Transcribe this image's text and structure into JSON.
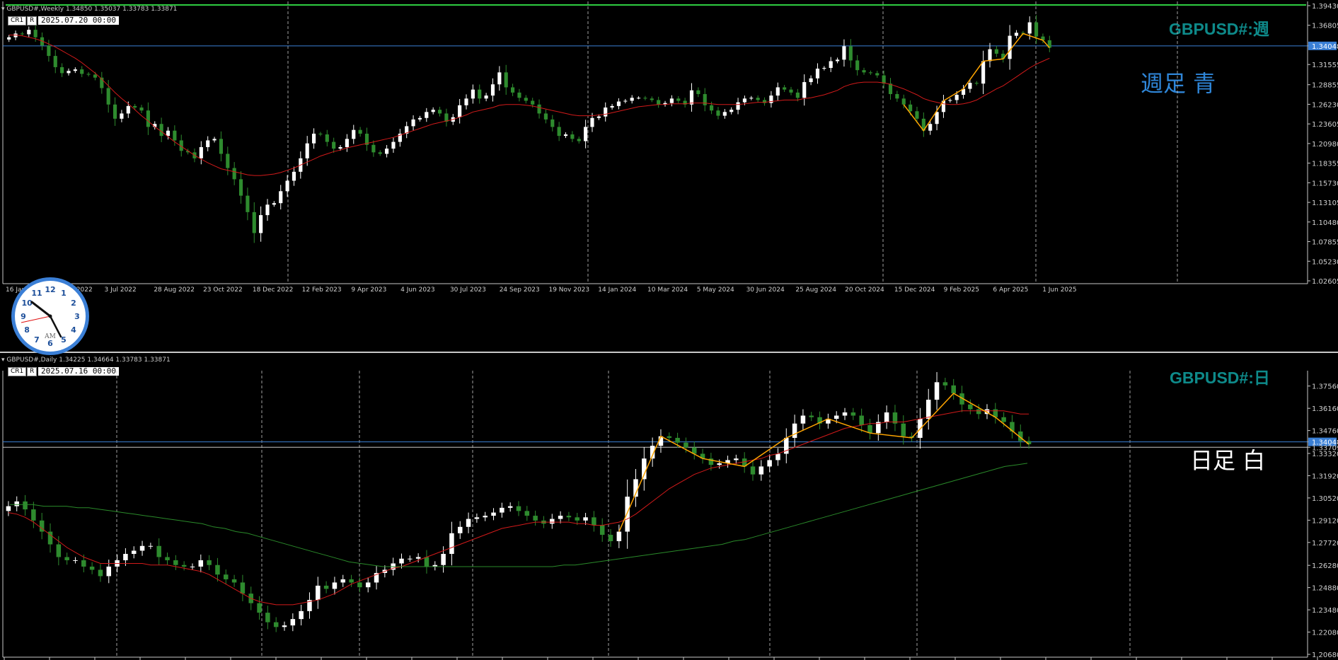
{
  "weekly": {
    "header": "GBPUSD#,Weekly  1.34850 1.35037 1.33783 1.33871",
    "tags": [
      "CR1",
      "R"
    ],
    "date": "2025.07.20 00:00",
    "symbol_label": "GBPUSD#:週",
    "note": "週足 青",
    "current_price_label": "1.34048"
  },
  "daily": {
    "header": "GBPUSD#,Daily  1.34225 1.34664 1.33783 1.33871",
    "tags": [
      "CR1",
      "R"
    ],
    "date": "2025.07.16 00:00",
    "symbol_label": "GBPUSD#:日",
    "note": "日足 白",
    "current_price_label": "1.34048",
    "secondary_price_label": "1.33709"
  },
  "clock": {
    "numbers": [
      "12",
      "1",
      "2",
      "3",
      "4",
      "5",
      "6",
      "7",
      "8",
      "9",
      "10",
      "11"
    ],
    "am_label": "AM"
  },
  "colors": {
    "background": "#000000",
    "bull_candle": "#ffffff",
    "bear_candle": "#2e8b2e",
    "ma_red": "#d21a1a",
    "ma_green": "#2a8a2a",
    "zigzag": "#ffa500",
    "price_line": "#3a7fd5",
    "grid": "#c8c8c8",
    "symbol_label": "#0e8a8a",
    "note_weekly": "#2f86d8",
    "note_daily": "#ffffff"
  },
  "chart_data": [
    {
      "type": "line",
      "title": "GBPUSD#,Weekly",
      "y_ticks": [
        "1.39430",
        "1.36805",
        "1.34048",
        "1.31555",
        "1.28855",
        "1.26230",
        "1.23605",
        "1.20980",
        "1.18355",
        "1.15730",
        "1.13105",
        "1.10480",
        "1.07855",
        "1.05230",
        "1.02605"
      ],
      "x_ticks": [
        "16 Jan 2022",
        "8 May 2022",
        "3 Jul 2022",
        "28 Aug 2022",
        "23 Oct 2022",
        "18 Dec 2022",
        "12 Feb 2023",
        "9 Apr 2023",
        "4 Jun 2023",
        "30 Jul 2023",
        "24 Sep 2023",
        "19 Nov 2023",
        "14 Jan 2024",
        "10 Mar 2024",
        "5 May 2024",
        "30 Jun 2024",
        "25 Aug 2024",
        "20 Oct 2024",
        "15 Dec 2024",
        "9 Feb 2025",
        "6 Apr 2025",
        "1 Jun 2025"
      ],
      "ylim": [
        1.02605,
        1.3943
      ],
      "price_line": 1.34048,
      "series": [
        {
          "name": "",
          "values": [
            1.352,
            1.357,
            1.356,
            1.362,
            1.352,
            1.341,
            1.327,
            1.312,
            1.304,
            1.307,
            1.309,
            1.303,
            1.302,
            1.298,
            1.284,
            1.262,
            1.243,
            1.25,
            1.26,
            1.258,
            1.254,
            1.232,
            1.236,
            1.22,
            1.227,
            1.214,
            1.2,
            1.198,
            1.19,
            1.205,
            1.214,
            1.216,
            1.196,
            1.177,
            1.162,
            1.14,
            1.118,
            1.09,
            1.114,
            1.128,
            1.13,
            1.146,
            1.16,
            1.172,
            1.19,
            1.21,
            1.223,
            1.222,
            1.212,
            1.203,
            1.205,
            1.216,
            1.228,
            1.223,
            1.208,
            1.198,
            1.196,
            1.203,
            1.212,
            1.223,
            1.233,
            1.242,
            1.244,
            1.252,
            1.255,
            1.25,
            1.239,
            1.245,
            1.261,
            1.27,
            1.282,
            1.27,
            1.274,
            1.289,
            1.305,
            1.285,
            1.278,
            1.271,
            1.267,
            1.262,
            1.25,
            1.242,
            1.232,
            1.22,
            1.222,
            1.216,
            1.213,
            1.232,
            1.244,
            1.246,
            1.258,
            1.26,
            1.266,
            1.267,
            1.271,
            1.271,
            1.27,
            1.268,
            1.262,
            1.264,
            1.27,
            1.267,
            1.262,
            1.281,
            1.276,
            1.261,
            1.254,
            1.247,
            1.252,
            1.255,
            1.265,
            1.27,
            1.271,
            1.268,
            1.264,
            1.274,
            1.285,
            1.282,
            1.278,
            1.271,
            1.292,
            1.297,
            1.31,
            1.311,
            1.32,
            1.322,
            1.34,
            1.321,
            1.308,
            1.305,
            1.304,
            1.301,
            1.29,
            1.276,
            1.27,
            1.262,
            1.253,
            1.243,
            1.227,
            1.236,
            1.252,
            1.267,
            1.268,
            1.275,
            1.283,
            1.291,
            1.29,
            1.32,
            1.336,
            1.33,
            1.323,
            1.354,
            1.358,
            1.357,
            1.372,
            1.353,
            1.348,
            1.338
          ]
        },
        {
          "name": "",
          "values": [
            1.355,
            1.355,
            1.354,
            1.352,
            1.35,
            1.347,
            1.343,
            1.339,
            1.334,
            1.329,
            1.324,
            1.318,
            1.311,
            1.304,
            1.296,
            1.287,
            1.278,
            1.27,
            1.263,
            1.255,
            1.247,
            1.24,
            1.232,
            1.226,
            1.219,
            1.212,
            1.206,
            1.2,
            1.194,
            1.189,
            1.184,
            1.18,
            1.176,
            1.174,
            1.172,
            1.17,
            1.168,
            1.167,
            1.167,
            1.168,
            1.169,
            1.171,
            1.174,
            1.177,
            1.181,
            1.185,
            1.189,
            1.193,
            1.196,
            1.199,
            1.201,
            1.204,
            1.206,
            1.208,
            1.21,
            1.212,
            1.214,
            1.216,
            1.218,
            1.221,
            1.224,
            1.227,
            1.23,
            1.233,
            1.236,
            1.238,
            1.24,
            1.242,
            1.245,
            1.248,
            1.252,
            1.254,
            1.256,
            1.258,
            1.261,
            1.262,
            1.262,
            1.262,
            1.261,
            1.26,
            1.258,
            1.256,
            1.254,
            1.252,
            1.25,
            1.248,
            1.247,
            1.247,
            1.247,
            1.248,
            1.249,
            1.251,
            1.253,
            1.255,
            1.257,
            1.259,
            1.26,
            1.261,
            1.262,
            1.262,
            1.263,
            1.263,
            1.263,
            1.264,
            1.264,
            1.264,
            1.263,
            1.262,
            1.262,
            1.262,
            1.262,
            1.263,
            1.264,
            1.265,
            1.265,
            1.266,
            1.267,
            1.268,
            1.268,
            1.268,
            1.27,
            1.271,
            1.273,
            1.275,
            1.278,
            1.281,
            1.286,
            1.289,
            1.291,
            1.292,
            1.292,
            1.292,
            1.291,
            1.289,
            1.286,
            1.283,
            1.279,
            1.275,
            1.27,
            1.267,
            1.265,
            1.263,
            1.262,
            1.262,
            1.263,
            1.265,
            1.268,
            1.273,
            1.278,
            1.283,
            1.287,
            1.293,
            1.299,
            1.305,
            1.311,
            1.316,
            1.32,
            1.324
          ]
        }
      ]
    },
    {
      "type": "line",
      "title": "GBPUSD#,Daily",
      "y_ticks": [
        "1.37560",
        "1.36160",
        "1.34760",
        "1.34048",
        "1.33709",
        "1.33320",
        "1.31920",
        "1.30520",
        "1.29120",
        "1.27720",
        "1.26280",
        "1.24880",
        "1.23480",
        "1.22080",
        "1.20680"
      ],
      "x_ticks": [],
      "ylim": [
        1.2068,
        1.3826
      ],
      "price_line": 1.34048,
      "series": [
        {
          "name": "",
          "values": [
            1.3,
            1.303,
            1.298,
            1.291,
            1.284,
            1.276,
            1.268,
            1.266,
            1.266,
            1.262,
            1.26,
            1.256,
            1.262,
            1.266,
            1.27,
            1.272,
            1.275,
            1.275,
            1.268,
            1.266,
            1.263,
            1.262,
            1.262,
            1.266,
            1.263,
            1.257,
            1.254,
            1.252,
            1.245,
            1.239,
            1.233,
            1.227,
            1.224,
            1.225,
            1.229,
            1.234,
            1.241,
            1.25,
            1.248,
            1.252,
            1.254,
            1.252,
            1.249,
            1.252,
            1.258,
            1.26,
            1.264,
            1.267,
            1.267,
            1.268,
            1.262,
            1.263,
            1.27,
            1.283,
            1.287,
            1.292,
            1.293,
            1.294,
            1.296,
            1.299,
            1.3,
            1.297,
            1.294,
            1.291,
            1.289,
            1.292,
            1.294,
            1.293,
            1.291,
            1.293,
            1.288,
            1.282,
            1.278,
            1.284,
            1.306,
            1.317,
            1.33,
            1.338,
            1.344,
            1.343,
            1.34,
            1.337,
            1.333,
            1.33,
            1.326,
            1.327,
            1.329,
            1.33,
            1.325,
            1.32,
            1.325,
            1.329,
            1.333,
            1.343,
            1.352,
            1.357,
            1.356,
            1.352,
            1.355,
            1.357,
            1.359,
            1.357,
            1.351,
            1.346,
            1.353,
            1.359,
            1.352,
            1.344,
            1.343,
            1.355,
            1.367,
            1.378,
            1.376,
            1.371,
            1.364,
            1.361,
            1.358,
            1.361,
            1.356,
            1.353,
            1.347,
            1.341,
            1.339
          ]
        },
        {
          "name": "",
          "values": [
            1.296,
            1.295,
            1.293,
            1.29,
            1.286,
            1.282,
            1.278,
            1.274,
            1.271,
            1.268,
            1.266,
            1.264,
            1.264,
            1.264,
            1.264,
            1.264,
            1.264,
            1.263,
            1.263,
            1.263,
            1.262,
            1.261,
            1.26,
            1.259,
            1.257,
            1.254,
            1.251,
            1.248,
            1.245,
            1.242,
            1.24,
            1.239,
            1.238,
            1.238,
            1.238,
            1.239,
            1.24,
            1.241,
            1.243,
            1.245,
            1.248,
            1.251,
            1.253,
            1.255,
            1.257,
            1.259,
            1.261,
            1.262,
            1.264,
            1.266,
            1.268,
            1.27,
            1.272,
            1.274,
            1.276,
            1.278,
            1.28,
            1.282,
            1.284,
            1.286,
            1.287,
            1.288,
            1.289,
            1.29,
            1.29,
            1.29,
            1.29,
            1.29,
            1.289,
            1.289,
            1.288,
            1.288,
            1.289,
            1.29,
            1.292,
            1.295,
            1.299,
            1.303,
            1.307,
            1.311,
            1.314,
            1.317,
            1.32,
            1.322,
            1.324,
            1.325,
            1.326,
            1.327,
            1.328,
            1.329,
            1.33,
            1.332,
            1.333,
            1.335,
            1.337,
            1.339,
            1.341,
            1.343,
            1.345,
            1.347,
            1.349,
            1.35,
            1.351,
            1.352,
            1.352,
            1.353,
            1.353,
            1.353,
            1.354,
            1.355,
            1.356,
            1.357,
            1.358,
            1.359,
            1.36,
            1.36,
            1.36,
            1.36,
            1.36,
            1.36,
            1.359,
            1.358,
            1.358
          ]
        },
        {
          "name": "",
          "values": [
            1.301,
            1.301,
            1.301,
            1.3,
            1.3,
            1.3,
            1.299,
            1.299,
            1.298,
            1.297,
            1.296,
            1.295,
            1.294,
            1.293,
            1.292,
            1.291,
            1.29,
            1.289,
            1.287,
            1.286,
            1.284,
            1.283,
            1.281,
            1.279,
            1.277,
            1.275,
            1.273,
            1.271,
            1.269,
            1.267,
            1.265,
            1.264,
            1.263,
            1.262,
            1.262,
            1.262,
            1.262,
            1.262,
            1.262,
            1.262,
            1.262,
            1.262,
            1.262,
            1.262,
            1.262,
            1.262,
            1.262,
            1.262,
            1.262,
            1.263,
            1.263,
            1.264,
            1.265,
            1.266,
            1.267,
            1.268,
            1.269,
            1.27,
            1.271,
            1.272,
            1.273,
            1.274,
            1.275,
            1.276,
            1.278,
            1.279,
            1.281,
            1.283,
            1.285,
            1.287,
            1.289,
            1.291,
            1.293,
            1.295,
            1.297,
            1.299,
            1.301,
            1.303,
            1.305,
            1.307,
            1.309,
            1.311,
            1.313,
            1.315,
            1.317,
            1.319,
            1.321,
            1.323,
            1.325,
            1.326,
            1.327
          ]
        }
      ]
    }
  ]
}
